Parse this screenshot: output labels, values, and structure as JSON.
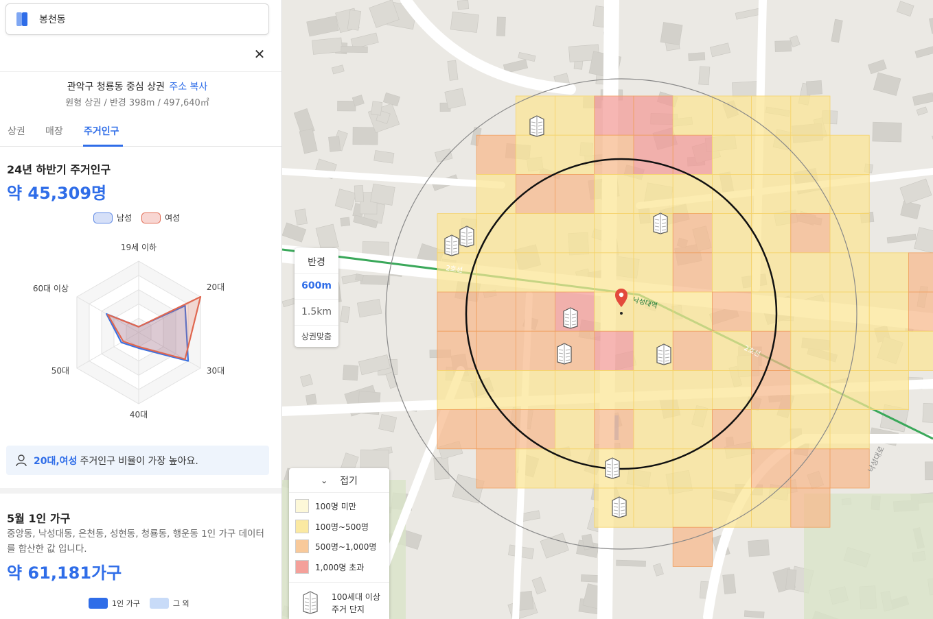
{
  "search": {
    "query": "봉천동"
  },
  "area": {
    "title": "관악구 청룡동 중심 상권",
    "copy_label": "주소 복사",
    "subtitle": "원형 상권 / 반경 398m / 497,640㎡"
  },
  "tabs": [
    {
      "label": "상권"
    },
    {
      "label": "매장"
    },
    {
      "label": "주거인구",
      "active": true
    }
  ],
  "population": {
    "title": "24년 하반기 주거인구",
    "total": "약 45,309명",
    "legend": {
      "male": "남성",
      "female": "여성"
    },
    "insight": {
      "highlight": "20대,여성",
      "text": "주거인구 비율이 가장 높아요."
    }
  },
  "chart_data": {
    "type": "radar",
    "categories": [
      "19세 이하",
      "20대",
      "30대",
      "40대",
      "50대",
      "60대 이상"
    ],
    "series": [
      {
        "name": "남성",
        "values": [
          0.08,
          0.75,
          0.8,
          0.22,
          0.28,
          0.52
        ],
        "color": "#3d72e0"
      },
      {
        "name": "여성",
        "values": [
          0.08,
          1.0,
          0.75,
          0.2,
          0.25,
          0.5
        ],
        "color": "#e0674f"
      }
    ],
    "rings": 5,
    "grid": true,
    "legend_position": "top-center"
  },
  "single_household": {
    "title": "5월 1인 가구",
    "description": "중앙동, 낙성대동, 은천동, 성현동, 청룡동, 행운동 1인 가구 데이터를 합산한 값 입니다.",
    "total": "약 61,181가구",
    "legend": {
      "single": "1인 가구",
      "other": "그 외"
    }
  },
  "radius_control": {
    "header": "반경",
    "options": [
      "600m",
      "1.5km"
    ],
    "selected": "600m",
    "fit": "상권맞춤"
  },
  "map_legend": {
    "toggle": "접기",
    "items": [
      {
        "label": "100명 미만",
        "color": "#fdf8d8"
      },
      {
        "label": "100명~500명",
        "color": "#fbe9a2"
      },
      {
        "label": "500명~1,000명",
        "color": "#f8c99a"
      },
      {
        "label": "1,000명 초과",
        "color": "#f4a09a"
      }
    ],
    "building": {
      "line1": "100세대 이상",
      "line2": "주거 단지"
    }
  },
  "map": {
    "line_label_1": "2호선",
    "line_label_2": "2호선",
    "station_label": "낙성대역",
    "road_label": "낙성대로",
    "subway_color": "#3aa85a",
    "pin_color": "#e34a3c"
  },
  "icons": {
    "close": "close-icon",
    "logo": "app-logo-icon",
    "person": "person-icon",
    "chevron": "chevron-down-icon",
    "building": "apartment-building-icon"
  }
}
